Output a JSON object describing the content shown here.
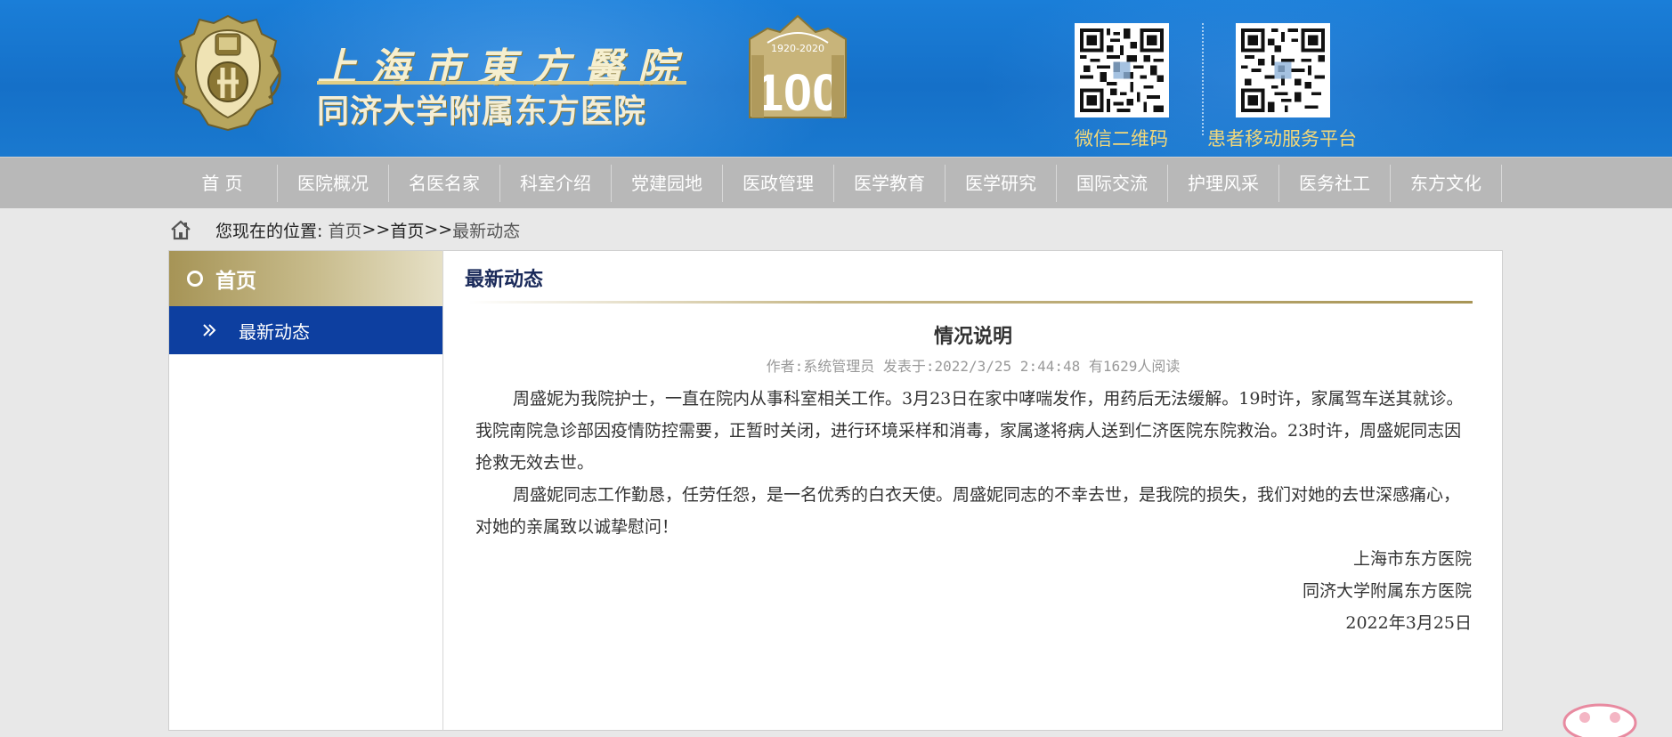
{
  "header": {
    "hospital_name_cn": "上海市東方醫院",
    "hospital_name_sub": "同济大学附属东方医院",
    "centennial_years": "1920-2020",
    "centennial_number": "100",
    "qr_codes": [
      {
        "label": "微信二维码"
      },
      {
        "label": "患者移动服务平台"
      }
    ]
  },
  "nav": {
    "items": [
      "首 页",
      "医院概况",
      "名医名家",
      "科室介绍",
      "党建园地",
      "医政管理",
      "医学教育",
      "医学研究",
      "国际交流",
      "护理风采",
      "医务社工",
      "东方文化"
    ]
  },
  "breadcrumb": {
    "prefix": "您现在的位置:",
    "home": "首页",
    "sep1": " >>",
    "level1": "首页",
    "sep2": ">>",
    "level2": "最新动态"
  },
  "sidebar": {
    "heading": "首页",
    "items": [
      {
        "label": "最新动态",
        "active": true
      }
    ]
  },
  "content": {
    "section_title": "最新动态",
    "article": {
      "title": "情况说明",
      "meta": "作者:系统管理员 发表于:2022/3/25 2:44:48 有1629人阅读",
      "paragraphs": [
        "周盛妮为我院护士，一直在院内从事科室相关工作。3月23日在家中哮喘发作，用药后无法缓解。19时许，家属驾车送其就诊。我院南院急诊部因疫情防控需要，正暂时关闭，进行环境采样和消毒，家属遂将病人送到仁济医院东院救治。23时许，周盛妮同志因抢救无效去世。",
        "周盛妮同志工作勤恳，任劳任怨，是一名优秀的白衣天使。周盛妮同志的不幸去世，是我院的损失，我们对她的去世深感痛心，对她的亲属致以诚挚慰问！"
      ],
      "signature": [
        "上海市东方医院",
        "同济大学附属东方医院",
        "2022年3月25日"
      ]
    }
  },
  "colors": {
    "header_blue": "#1570c8",
    "gold": "#a69456",
    "nav_gray": "#b8b8b8",
    "sidebar_active": "#0d3fa0"
  }
}
